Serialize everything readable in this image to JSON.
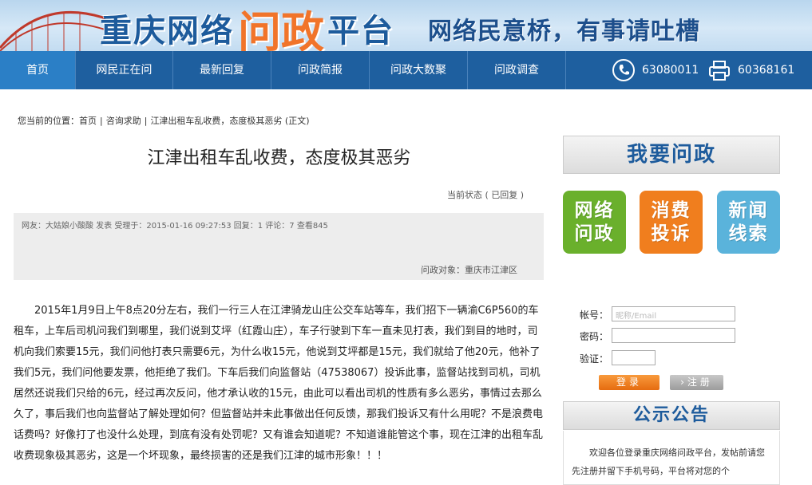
{
  "banner": {
    "title_part1": "重庆网络",
    "title_accent": "问政",
    "title_part2": "平台",
    "slogan": "网络民意桥，有事请吐槽"
  },
  "nav": {
    "items": [
      {
        "label": "首页"
      },
      {
        "label": "网民正在问"
      },
      {
        "label": "最新回复"
      },
      {
        "label": "问政简报"
      },
      {
        "label": "问政大数聚"
      },
      {
        "label": "问政调查"
      }
    ],
    "phone1": "63080011",
    "phone2": "60368161"
  },
  "breadcrumb": {
    "prefix": "您当前的位置：",
    "home": "首页",
    "category": "咨询求助",
    "current": "江津出租车乱收费，态度极其恶劣 (正文)"
  },
  "article": {
    "title": "江津出租车乱收费，态度极其恶劣",
    "status": "当前状态 ( 已回复 )",
    "meta_line": "网友：大姑娘小酸酸 发表  受理于：2015-01-16 09:27:53  回复：1  评论：7  查看845",
    "target": "问政对象：重庆市江津区",
    "body": "2015年1月9日上午8点20分左右，我们一行三人在江津骑龙山庄公交车站等车，我们招下一辆渝C6P560的车租车，上车后司机问我们到哪里，我们说到艾坪（红霞山庄），车子行驶到下车一直未见打表，我们到目的地时，司机向我们索要15元，我们问他打表只需要6元，为什么收15元，他说到艾坪都是15元，我们就给了他20元，他补了我们5元，我们问他要发票，他拒绝了我们。下车后我们向监督站（47538067）投诉此事，监督站找到司机，司机居然还说我们只给的6元，经过再次反问，他才承认收的15元，由此可以看出司机的性质有多么恶劣，事情过去那么久了，事后我们也向监督站了解处理如何？但监督站并未此事做出任何反馈，那我们投诉又有什么用呢？不是浪费电话费吗？好像打了也没什么处理，到底有没有处罚呢？又有谁会知道呢？不知道谁能管这个事，现在江津的出租车乱收费现象极其恶劣，这是一个坏现象，最终损害的还是我们江津的城市形象！！！"
  },
  "sidebar": {
    "ask_button": "我要问政",
    "tiles": [
      {
        "label": "网络问政",
        "color": "#6ab02c"
      },
      {
        "label": "消费投诉",
        "color": "#f07e1e"
      },
      {
        "label": "新闻线索",
        "color": "#5ab3db"
      }
    ],
    "login": {
      "account_label": "帐号：",
      "account_placeholder": "昵称/Email",
      "password_label": "密码：",
      "captcha_label": "验证：",
      "login_button": "登录",
      "register_button": "注册"
    },
    "notice_title": "公示公告",
    "notice_text": "欢迎各位登录重庆网络问政平台，发帖前请您先注册并留下手机号码，平台将对您的个"
  },
  "colors": {
    "nav_bg": "#1e5f9f",
    "brand_blue": "#1d5b9c",
    "accent_orange": "#f1742a"
  }
}
